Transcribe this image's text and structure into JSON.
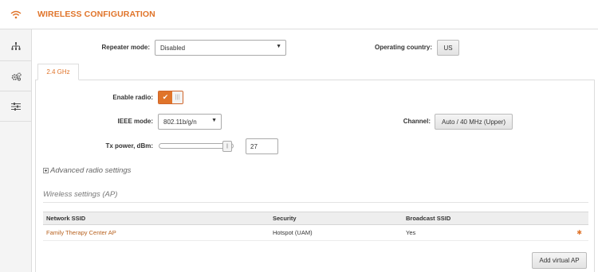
{
  "header": {
    "title": "WIRELESS CONFIGURATION"
  },
  "sidebar": {
    "items": [
      {
        "icon": "wifi-icon",
        "active": true
      },
      {
        "icon": "network-tree-icon",
        "active": false
      },
      {
        "icon": "gears-icon",
        "active": false
      },
      {
        "icon": "sliders-icon",
        "active": false
      }
    ]
  },
  "repeater": {
    "label": "Repeater mode:",
    "value": "Disabled"
  },
  "country": {
    "label": "Operating country:",
    "value": "US"
  },
  "tabs": [
    {
      "label": "2.4 GHz",
      "active": true
    }
  ],
  "radio": {
    "enable_label": "Enable radio:",
    "enabled": true,
    "ieee_label": "IEEE mode:",
    "ieee_value": "802.11b/g/n",
    "channel_label": "Channel:",
    "channel_value": "Auto / 40 MHz (Upper)",
    "txpower_label": "Tx power, dBm:",
    "txpower_value": "27"
  },
  "advanced": {
    "label": "Advanced radio settings"
  },
  "ap_section": {
    "title": "Wireless settings (AP)",
    "columns": [
      "Network SSID",
      "Security",
      "Broadcast SSID"
    ],
    "rows": [
      {
        "ssid": "Family Therapy Center AP",
        "security": "Hotspot (UAM)",
        "broadcast": "Yes"
      }
    ],
    "add_button": "Add virtual AP"
  },
  "colors": {
    "accent": "#e0742a"
  }
}
